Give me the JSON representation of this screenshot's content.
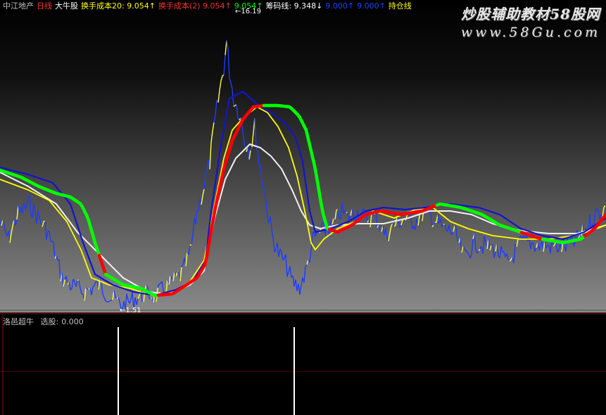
{
  "header": {
    "stock_name": "中江地产",
    "period": "日线",
    "indicator": "大牛股",
    "turnover_cost_label": "换手成本20: 9.054↑",
    "turnover_cost2_label": "换手成本(2)  9.054↑",
    "value3_label": "9.054↑",
    "chip_line_label": "筹码线: 9.348↓",
    "blue_label1": "9.000↑",
    "blue_label2": "9.000↑",
    "hold_line_label": "持仓线"
  },
  "watermark": {
    "line1": "炒股辅助教材58股网",
    "line2": "www.58Gu.com"
  },
  "annotations": {
    "high_label": "16.19",
    "low_label": "1.51"
  },
  "sub_panel": {
    "title": "洛邑超牛",
    "select_label": "选股:",
    "select_value": "0.000"
  },
  "colors": {
    "price": "#1e3cff",
    "price_up": "#ffff40",
    "white_line": "#f0f0f0",
    "yellow_line": "#ffff00",
    "blue_line": "#1414c8",
    "band_red": "#ff0000",
    "band_green": "#00ff00",
    "header_red": "#ff3030",
    "header_green": "#00ff00",
    "header_yellow": "#ffff00",
    "header_blue": "#2040ff"
  },
  "sub_signals": [
    168,
    418
  ]
}
